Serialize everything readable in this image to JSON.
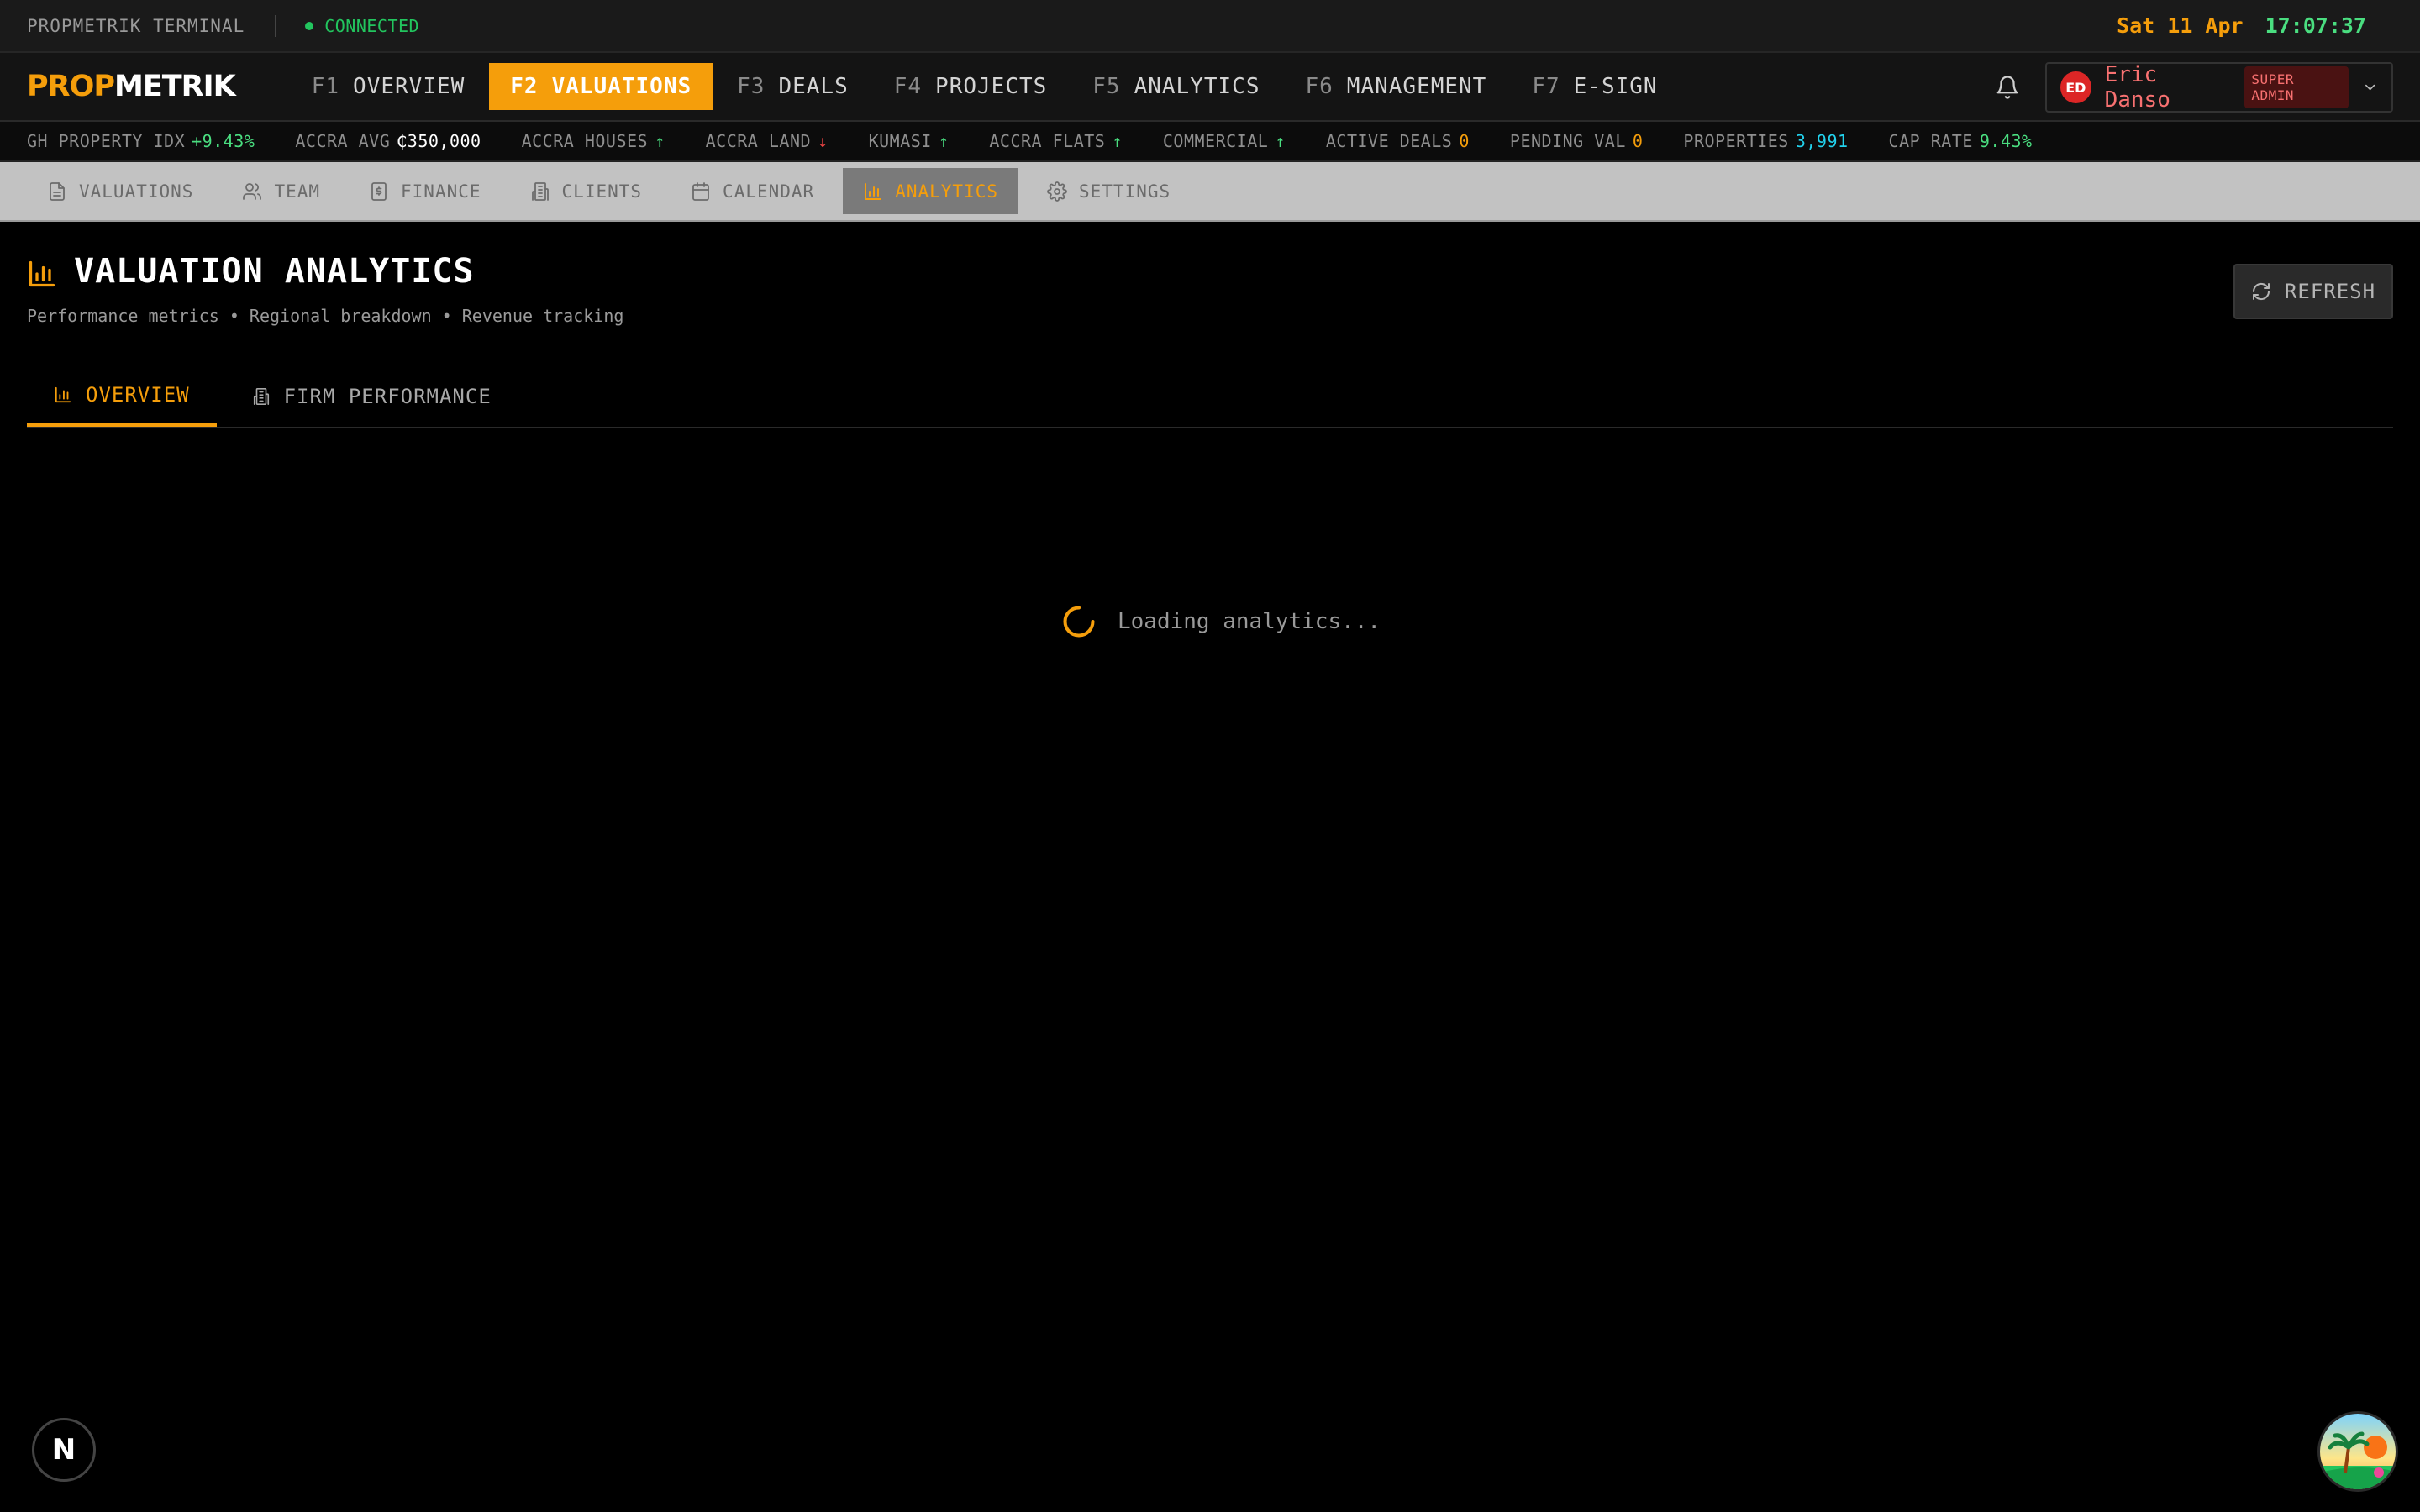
{
  "statusbar": {
    "title": "PROPMETRIK TERMINAL",
    "connection": "CONNECTED",
    "date": "Sat 11 Apr",
    "time": "17:07:37"
  },
  "brand": {
    "part1": "PROP",
    "part2": "METRIK"
  },
  "nav": {
    "items": [
      {
        "key": "F1",
        "label": "OVERVIEW"
      },
      {
        "key": "F2",
        "label": "VALUATIONS"
      },
      {
        "key": "F3",
        "label": "DEALS"
      },
      {
        "key": "F4",
        "label": "PROJECTS"
      },
      {
        "key": "F5",
        "label": "ANALYTICS"
      },
      {
        "key": "F6",
        "label": "MANAGEMENT"
      },
      {
        "key": "F7",
        "label": "E-SIGN"
      }
    ]
  },
  "user": {
    "initials": "ED",
    "name": "Eric Danso",
    "role": "SUPER ADMIN"
  },
  "ticker": [
    {
      "label": "GH PROPERTY IDX",
      "value": "+9.43%"
    },
    {
      "label": "ACCRA AVG",
      "value": "₵350,000"
    },
    {
      "label": "ACCRA HOUSES",
      "value": "↑"
    },
    {
      "label": "ACCRA LAND",
      "value": "↓"
    },
    {
      "label": "KUMASI",
      "value": "↑"
    },
    {
      "label": "ACCRA FLATS",
      "value": "↑"
    },
    {
      "label": "COMMERCIAL",
      "value": "↑"
    },
    {
      "label": "ACTIVE DEALS",
      "value": "0"
    },
    {
      "label": "PENDING VAL",
      "value": "0"
    },
    {
      "label": "PROPERTIES",
      "value": "3,991"
    },
    {
      "label": "CAP RATE",
      "value": "9.43%"
    }
  ],
  "subnav": {
    "items": [
      {
        "label": "VALUATIONS"
      },
      {
        "label": "TEAM"
      },
      {
        "label": "FINANCE"
      },
      {
        "label": "CLIENTS"
      },
      {
        "label": "CALENDAR"
      },
      {
        "label": "ANALYTICS"
      },
      {
        "label": "SETTINGS"
      }
    ]
  },
  "page": {
    "title": "VALUATION ANALYTICS",
    "subtitle": "Performance metrics • Regional breakdown • Revenue tracking",
    "refresh_label": "REFRESH"
  },
  "tabs": [
    {
      "label": "OVERVIEW"
    },
    {
      "label": "FIRM PERFORMANCE"
    }
  ],
  "loading_text": "Loading analytics...",
  "floating": {
    "n_label": "N"
  },
  "colors": {
    "accent": "#f59e0b",
    "positive": "#4ade80",
    "negative": "#ef4444",
    "info": "#22d3ee",
    "danger": "#dc2626"
  }
}
